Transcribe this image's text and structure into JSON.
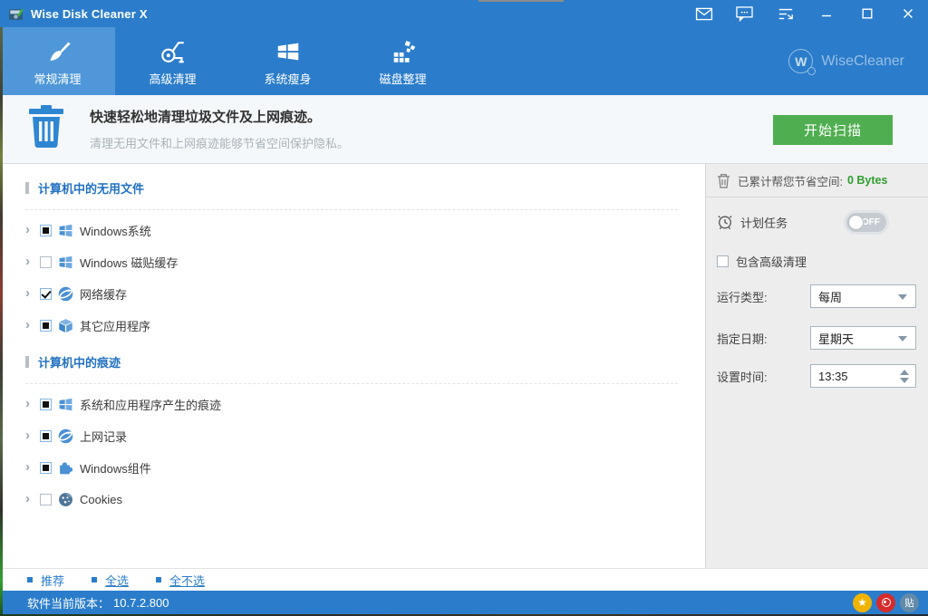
{
  "window": {
    "title": "Wise Disk Cleaner X",
    "controls": [
      "mail",
      "feedback",
      "menu",
      "minimize",
      "maximize",
      "close"
    ]
  },
  "brand": {
    "name": "WiseCleaner",
    "logo_letter": "W"
  },
  "tabs": [
    {
      "id": "normal-clean",
      "label": "常规清理",
      "icon": "brush",
      "active": true
    },
    {
      "id": "advanced-clean",
      "label": "高级清理",
      "icon": "vacuum",
      "active": false
    },
    {
      "id": "system-slim",
      "label": "系统瘦身",
      "icon": "windows",
      "active": false
    },
    {
      "id": "disk-defrag",
      "label": "磁盘整理",
      "icon": "defrag",
      "active": false
    }
  ],
  "header": {
    "title": "快速轻松地清理垃圾文件及上网痕迹。",
    "subtitle": "清理无用文件和上网痕迹能够节省空间保护隐私。",
    "scan_button": "开始扫描"
  },
  "sections": [
    {
      "title": "计算机中的无用文件",
      "items": [
        {
          "label": "Windows系统",
          "icon": "windows",
          "state": "partial"
        },
        {
          "label": "Windows 磁贴缓存",
          "icon": "windows",
          "state": "unchecked"
        },
        {
          "label": "网络缓存",
          "icon": "globe",
          "state": "checked"
        },
        {
          "label": "其它应用程序",
          "icon": "cube",
          "state": "partial"
        }
      ]
    },
    {
      "title": "计算机中的痕迹",
      "items": [
        {
          "label": "系统和应用程序产生的痕迹",
          "icon": "windows",
          "state": "partial"
        },
        {
          "label": "上网记录",
          "icon": "globe",
          "state": "partial"
        },
        {
          "label": "Windows组件",
          "icon": "puzzle",
          "state": "partial"
        },
        {
          "label": "Cookies",
          "icon": "cookie",
          "state": "unchecked"
        }
      ]
    }
  ],
  "side_panel": {
    "savings_label": "已累计帮您节省空间:",
    "savings_value": "0 Bytes",
    "schedule_label": "计划任务",
    "toggle_state": "OFF",
    "include_advanced_label": "包含高级清理",
    "run_type_label": "运行类型:",
    "run_type_value": "每周",
    "date_label": "指定日期:",
    "date_value": "星期天",
    "time_label": "设置时间:",
    "time_value": "13:35"
  },
  "footer": {
    "links": [
      "推荐",
      "全选",
      "全不选"
    ],
    "version_label": "软件当前版本：",
    "version_value": "10.7.2.800",
    "star_glyph": "★",
    "tieba_label": "贴"
  },
  "colors": {
    "titlebar_blue": "#2b7dcb",
    "active_tab_blue": "#4f97d8",
    "scan_green": "#4fae50",
    "link_blue": "#2b7dcb",
    "section_blue": "#2372c2",
    "savings_green": "#2f9e2f"
  }
}
